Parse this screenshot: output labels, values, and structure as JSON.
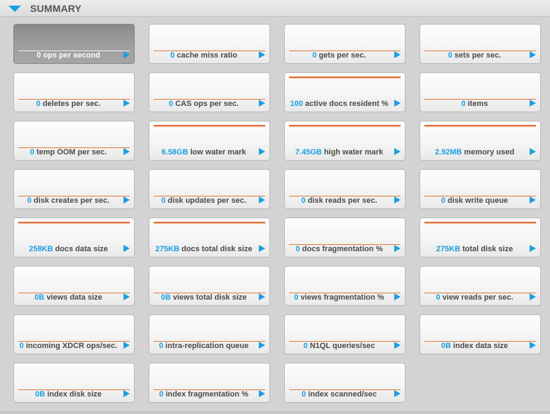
{
  "header": {
    "title": "SUMMARY"
  },
  "colors": {
    "accent": "#1a9fe0",
    "spark": "#e07a3c"
  },
  "tiles": [
    {
      "value": "0",
      "label": "ops per second",
      "selected": true,
      "level": 0
    },
    {
      "value": "0",
      "label": "cache miss ratio",
      "level": 0
    },
    {
      "value": "0",
      "label": "gets per sec.",
      "level": 0
    },
    {
      "value": "0",
      "label": "sets per sec.",
      "level": 0
    },
    {
      "value": "0",
      "label": "deletes per sec.",
      "level": 0
    },
    {
      "value": "0",
      "label": "CAS ops per sec.",
      "level": 0
    },
    {
      "value": "100",
      "label": "active docs resident %",
      "level": 1
    },
    {
      "value": "0",
      "label": "items",
      "level": 0
    },
    {
      "value": "0",
      "label": "temp OOM per sec.",
      "level": 0
    },
    {
      "value": "6.58GB",
      "label": "low water mark",
      "level": 1
    },
    {
      "value": "7.45GB",
      "label": "high water mark",
      "level": 1
    },
    {
      "value": "2.92MB",
      "label": "memory used",
      "level": 1
    },
    {
      "value": "0",
      "label": "disk creates per sec.",
      "level": 0
    },
    {
      "value": "0",
      "label": "disk updates per sec.",
      "level": 0
    },
    {
      "value": "0",
      "label": "disk reads per sec.",
      "level": 0
    },
    {
      "value": "0",
      "label": "disk write queue",
      "level": 0
    },
    {
      "value": "258KB",
      "label": "docs data size",
      "level": 1
    },
    {
      "value": "275KB",
      "label": "docs total disk size",
      "level": 1
    },
    {
      "value": "0",
      "label": "docs fragmentation %",
      "level": 0
    },
    {
      "value": "275KB",
      "label": "total disk size",
      "level": 1
    },
    {
      "value": "0B",
      "label": "views data size",
      "level": 0
    },
    {
      "value": "0B",
      "label": "views total disk size",
      "level": 0
    },
    {
      "value": "0",
      "label": "views fragmentation %",
      "level": 0
    },
    {
      "value": "0",
      "label": "view reads per sec.",
      "level": 0
    },
    {
      "value": "0",
      "label": "incoming XDCR ops/sec.",
      "level": 0
    },
    {
      "value": "0",
      "label": "intra-replication queue",
      "level": 0
    },
    {
      "value": "0",
      "label": "N1QL queries/sec",
      "level": 0
    },
    {
      "value": "0B",
      "label": "index data size",
      "level": 0
    },
    {
      "value": "0B",
      "label": "index disk size",
      "level": 0
    },
    {
      "value": "0",
      "label": "index fragmentation %",
      "level": 0
    },
    {
      "value": "0",
      "label": "index scanned/sec",
      "level": 0
    }
  ]
}
